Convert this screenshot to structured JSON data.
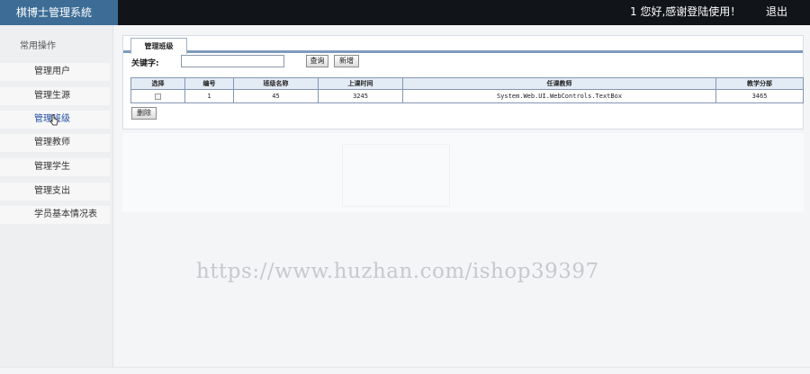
{
  "header": {
    "title": "棋博士管理系統",
    "welcome": "1 您好,感谢登陆使用！",
    "logout_label": "退出"
  },
  "sidebar": {
    "heading": "常用操作",
    "items": [
      {
        "label": "管理用户"
      },
      {
        "label": "管理生源"
      },
      {
        "label": "管理班级"
      },
      {
        "label": "管理教师"
      },
      {
        "label": "管理学生"
      },
      {
        "label": "管理支出"
      },
      {
        "label": "学员基本情况表"
      }
    ],
    "active_index": 2
  },
  "main": {
    "tab_label": "管理班级",
    "search": {
      "label": "关键字:",
      "value": "",
      "placeholder": ""
    },
    "query_button": "查询",
    "new_button": "新增",
    "delete_button": "删除",
    "table": {
      "headers": [
        "选择",
        "编号",
        "班级名称",
        "上课时间",
        "任课教师",
        "教学分部"
      ],
      "rows": [
        {
          "id": "1",
          "class_name": "45",
          "time": "3245",
          "teacher": "System.Web.UI.WebControls.TextBox",
          "branch": "3465"
        }
      ]
    }
  },
  "watermark": "https://www.huzhan.com/ishop39397",
  "colors": {
    "topbar": "#111418",
    "brand": "#3d6d96",
    "tab_border": "#7e9bbd",
    "table_header": "#e3ebf4"
  }
}
